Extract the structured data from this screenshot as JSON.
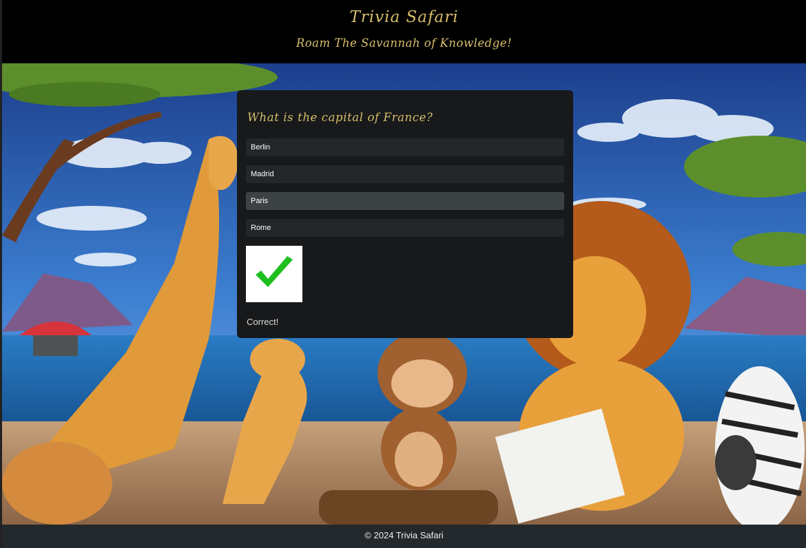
{
  "header": {
    "title": "Trivia Safari",
    "subtitle": "Roam The Savannah of Knowledge!"
  },
  "quiz": {
    "question": "What is the capital of France?",
    "answers": [
      "Berlin",
      "Madrid",
      "Paris",
      "Rome"
    ],
    "selected_answer": "Paris",
    "result_icon": "green-checkmark-icon",
    "result_text": "Correct!"
  },
  "background": {
    "description_icon": "savannah-animals-illustration",
    "colors": {
      "sky": "#3a77c9",
      "sea": "#1f6fb0",
      "sand": "#b9916a"
    }
  },
  "footer": {
    "copyright": "© 2024 Trivia Safari"
  },
  "colors": {
    "accent_gold": "#d8bf6a",
    "card_bg": "#17191b",
    "answer_bg": "#242729",
    "answer_selected_bg": "#3d4244",
    "check_green": "#1fbf1f"
  }
}
